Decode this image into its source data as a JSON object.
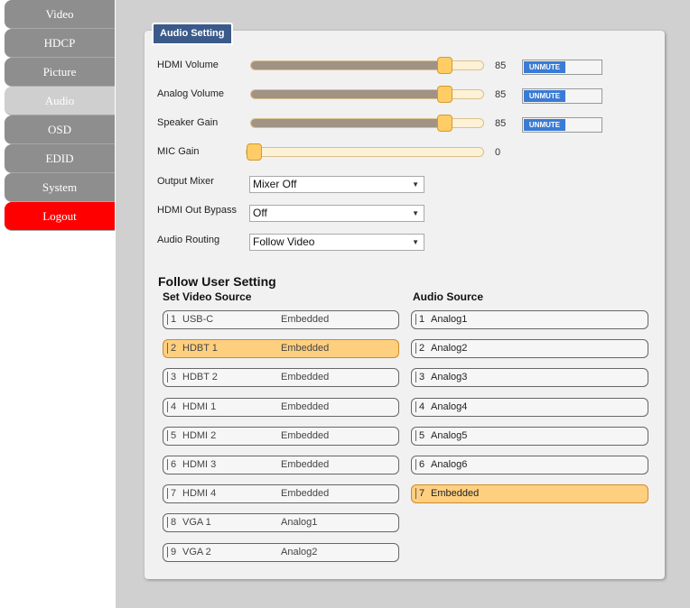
{
  "sidebar": {
    "items": [
      {
        "label": "Video"
      },
      {
        "label": "HDCP"
      },
      {
        "label": "Picture"
      },
      {
        "label": "Audio"
      },
      {
        "label": "OSD"
      },
      {
        "label": "EDID"
      },
      {
        "label": "System"
      },
      {
        "label": "Logout"
      }
    ],
    "active": "Audio"
  },
  "panel": {
    "title": "Audio Setting",
    "sliders": [
      {
        "label": "HDMI Volume",
        "value": "85",
        "level": 85,
        "toggle": "UNMUTE"
      },
      {
        "label": "Analog Volume",
        "value": "85",
        "level": 85,
        "toggle": "UNMUTE"
      },
      {
        "label": "Speaker Gain",
        "value": "85",
        "level": 85,
        "toggle": "UNMUTE"
      },
      {
        "label": "MIC Gain",
        "value": "0",
        "level": 0
      }
    ],
    "selects": [
      {
        "label": "Output Mixer",
        "value": "Mixer Off"
      },
      {
        "label": "HDMI Out Bypass",
        "value": "Off"
      },
      {
        "label": "Audio Routing",
        "value": "Follow Video"
      }
    ],
    "follow_title": "Follow User Setting",
    "video_col_title": "Set Video Source",
    "audio_col_title": "Audio Source",
    "video_sources": [
      {
        "num": "1",
        "name": "USB-C",
        "type": "Embedded",
        "selected": false
      },
      {
        "num": "2",
        "name": "HDBT 1",
        "type": "Embedded",
        "selected": true
      },
      {
        "num": "3",
        "name": "HDBT 2",
        "type": "Embedded",
        "selected": false
      },
      {
        "num": "4",
        "name": "HDMI 1",
        "type": "Embedded",
        "selected": false
      },
      {
        "num": "5",
        "name": "HDMI 2",
        "type": "Embedded",
        "selected": false
      },
      {
        "num": "6",
        "name": "HDMI 3",
        "type": "Embedded",
        "selected": false
      },
      {
        "num": "7",
        "name": "HDMI 4",
        "type": "Embedded",
        "selected": false
      },
      {
        "num": "8",
        "name": "VGA 1",
        "type": "Analog1",
        "selected": false
      },
      {
        "num": "9",
        "name": "VGA 2",
        "type": "Analog2",
        "selected": false
      }
    ],
    "audio_sources": [
      {
        "num": "1",
        "name": "Analog1",
        "selected": false
      },
      {
        "num": "2",
        "name": "Analog2",
        "selected": false
      },
      {
        "num": "3",
        "name": "Analog3",
        "selected": false
      },
      {
        "num": "4",
        "name": "Analog4",
        "selected": false
      },
      {
        "num": "5",
        "name": "Analog5",
        "selected": false
      },
      {
        "num": "6",
        "name": "Analog6",
        "selected": false
      },
      {
        "num": "7",
        "name": "Embedded",
        "selected": true
      }
    ]
  },
  "colors": {
    "accent": "#3b5a8a",
    "selected": "#ffcf80",
    "logout": "#ff0000",
    "toggle": "#3a7bd5"
  }
}
